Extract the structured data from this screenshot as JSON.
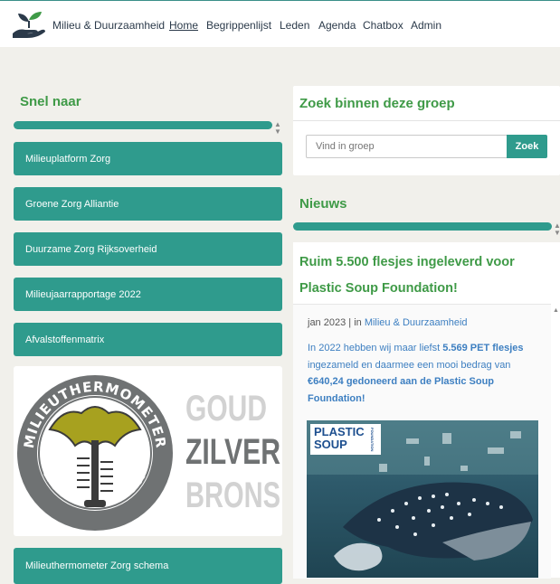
{
  "header": {
    "brand": "Milieu & Duurzaamheid",
    "nav": [
      "Home",
      "Begrippenlijst",
      "Leden",
      "Agenda",
      "Chatbox",
      "Admin"
    ],
    "active_nav": "Home"
  },
  "left": {
    "heading": "Snel naar",
    "links": [
      "Milieuplatform Zorg",
      "Groene Zorg Alliantie",
      "Duurzame Zorg Rijksoverheid",
      "Milieujaarrapportage 2022",
      "Afvalstoffenmatrix"
    ],
    "thermometer": {
      "ring_top": "MILIEUTHERMOMETER",
      "ring_bottom": "ZORGSECTOR",
      "levels": [
        "GOUD",
        "ZILVER",
        "BRONS"
      ]
    },
    "bottom_link": "Milieuthermometer Zorg schema"
  },
  "search": {
    "heading": "Zoek binnen deze groep",
    "placeholder": "Vind in groep",
    "button": "Zoek"
  },
  "news": {
    "heading": "Nieuws",
    "title": "Ruim 5.500 flesjes ingeleverd voor Plastic Soup Foundation!",
    "date": "jan 2023",
    "in_label": " | in ",
    "category": "Milieu & Duurzaamheid",
    "body_1": "In 2022 hebben wij maar liefst ",
    "body_bold_1": "5.569 PET flesjes",
    "body_2": " ingezameld en daarmee een mooi bedrag van ",
    "body_bold_2": "€640,24 gedoneerd aan de Plastic Soup Foundation!",
    "image_logo_1": "PLASTIC",
    "image_logo_2": "SOUP",
    "image_logo_small": "FOUNDATION"
  },
  "colors": {
    "teal": "#2f9b8d",
    "green_heading": "#3f9a47",
    "link_blue": "#3d7fc1"
  }
}
